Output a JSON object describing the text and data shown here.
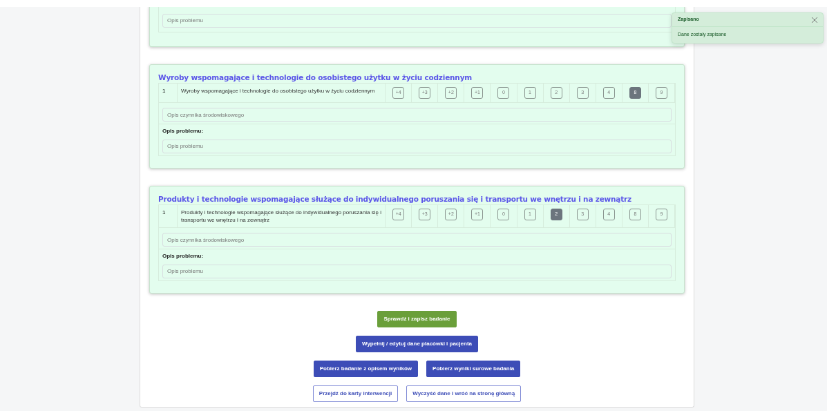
{
  "partial_section": {
    "problem_placeholder": "Opis problemu"
  },
  "sections": [
    {
      "title": "Wyroby wspomagające i technologie do osobistego użytku w życiu codziennym",
      "items": [
        {
          "number": "1",
          "text": "Wyroby wspomagające i technologie do osobistego użytku w życiu codziennym",
          "scores": [
            {
              "label": "+4",
              "selected": false
            },
            {
              "label": "+3",
              "selected": false
            },
            {
              "label": "+2",
              "selected": false
            },
            {
              "label": "+1",
              "selected": false
            },
            {
              "label": "0",
              "selected": false
            },
            {
              "label": "1",
              "selected": false
            },
            {
              "label": "2",
              "selected": false
            },
            {
              "label": "3",
              "selected": false
            },
            {
              "label": "4",
              "selected": false
            },
            {
              "label": "8",
              "selected": true
            },
            {
              "label": "9",
              "selected": false
            }
          ],
          "factor_placeholder": "Opis czynnika środowiskowego",
          "problem_label": "Opis problemu:",
          "problem_placeholder": "Opis problemu"
        }
      ]
    },
    {
      "title": "Produkty i technologie wspomagające służące do indywidualnego poruszania się i transportu we wnętrzu i na zewnątrz",
      "items": [
        {
          "number": "1",
          "text": "Produkty i technologie wspomagające służące do indywidualnego poruszania się i transportu we wnętrzu i na zewnątrz",
          "scores": [
            {
              "label": "+4",
              "selected": false
            },
            {
              "label": "+3",
              "selected": false
            },
            {
              "label": "+2",
              "selected": false
            },
            {
              "label": "+1",
              "selected": false
            },
            {
              "label": "0",
              "selected": false
            },
            {
              "label": "1",
              "selected": false
            },
            {
              "label": "2",
              "selected": true
            },
            {
              "label": "3",
              "selected": false
            },
            {
              "label": "4",
              "selected": false
            },
            {
              "label": "8",
              "selected": false
            },
            {
              "label": "9",
              "selected": false
            }
          ],
          "factor_placeholder": "Opis czynnika środowiskowego",
          "problem_label": "Opis problemu:",
          "problem_placeholder": "Opis problemu"
        }
      ]
    }
  ],
  "button_rows": [
    [
      {
        "label": "Sprawdź i zapisz badanie",
        "kind": "success"
      }
    ],
    [
      {
        "label": "Wypełnij / edytuj dane placówki i pacjenta",
        "kind": "primary"
      }
    ],
    [
      {
        "label": "Pobierz badanie z opisem wyników",
        "kind": "primary"
      },
      {
        "label": "Pobierz wyniki surowe badania",
        "kind": "primary"
      }
    ],
    [
      {
        "label": "Przejdź do karty interwencji",
        "kind": "outline"
      },
      {
        "label": "Wyczyść dane i wróć na stronę główną",
        "kind": "outline"
      }
    ]
  ],
  "toast": {
    "title": "Zapisano",
    "message": "Dane zostały zapisane"
  }
}
